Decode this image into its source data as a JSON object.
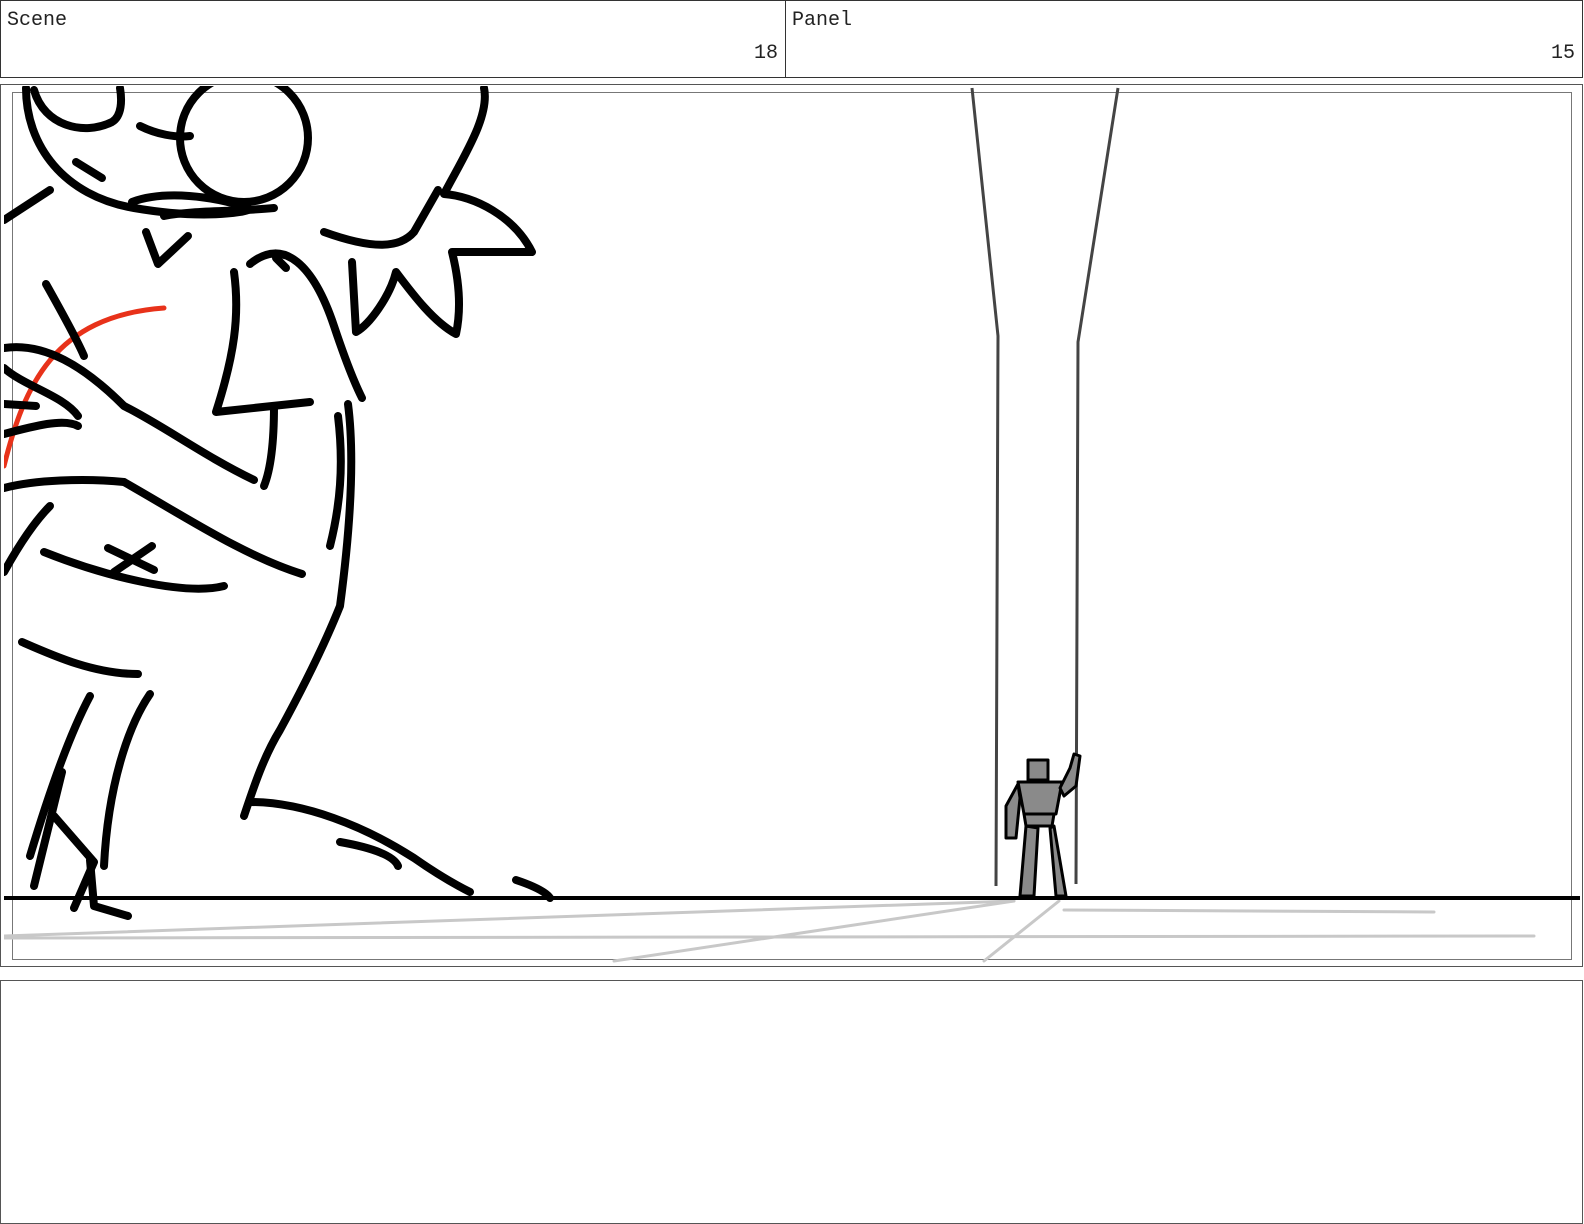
{
  "header": {
    "scene_label": "Scene",
    "scene_number": "18",
    "panel_label": "Panel",
    "panel_number": "15"
  },
  "panel": {
    "ink_color": "#000000",
    "accent_stroke_color": "#e8321a",
    "robot_fill_color": "#8a8a8a",
    "floor_guide_color": "#c8c8c8"
  },
  "notes": {
    "text": ""
  }
}
